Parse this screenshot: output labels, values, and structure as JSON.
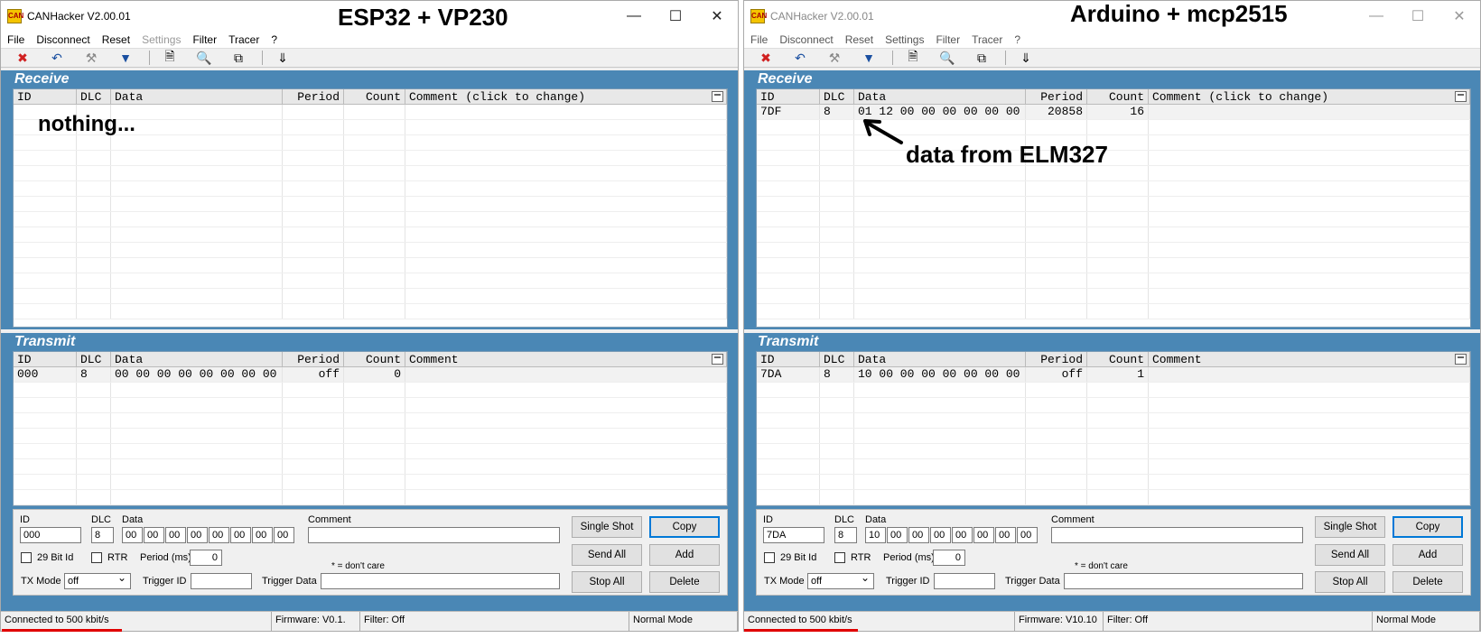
{
  "overlays": {
    "left_title": "ESP32 + VP230",
    "right_title": "Arduino + mcp2515",
    "left_note": "nothing...",
    "right_note": "data from ELM327",
    "right_arrow_icon": "arrow-up-left-icon"
  },
  "colors": {
    "panel": "#4a87b5",
    "accent": "#0078d7",
    "status_underline": "#e00000"
  },
  "left": {
    "title": "CANHacker V2.00.01",
    "menu": [
      "File",
      "Disconnect",
      "Reset",
      "Settings",
      "Filter",
      "Tracer",
      "?"
    ],
    "receive": {
      "heading": "Receive",
      "columns": [
        "ID",
        "DLC",
        "Data",
        "Period",
        "Count",
        "Comment (click to change)"
      ],
      "rows": []
    },
    "transmit": {
      "heading": "Transmit",
      "columns": [
        "ID",
        "DLC",
        "Data",
        "Period",
        "Count",
        "Comment"
      ],
      "rows": [
        {
          "id": "000",
          "dlc": "8",
          "data": "00 00 00 00 00 00 00 00",
          "period": "off",
          "count": "0",
          "comment": ""
        }
      ]
    },
    "editor": {
      "id_label": "ID",
      "id_value": "000",
      "dlc_label": "DLC",
      "dlc_value": "8",
      "data_label": "Data",
      "data_bytes": [
        "00",
        "00",
        "00",
        "00",
        "00",
        "00",
        "00",
        "00"
      ],
      "comment_label": "Comment",
      "comment_value": "",
      "bit29_label": "29 Bit Id",
      "rtr_label": "RTR",
      "period_label": "Period (ms)",
      "period_value": "0",
      "dont_care": "* = don't care",
      "txmode_label": "TX Mode",
      "txmode_value": "off",
      "trigger_id_label": "Trigger ID",
      "trigger_data_label": "Trigger Data",
      "buttons": {
        "single_shot": "Single Shot",
        "copy": "Copy",
        "send_all": "Send All",
        "add": "Add",
        "stop_all": "Stop All",
        "delete": "Delete"
      }
    },
    "status": {
      "connection": "Connected to 500 kbit/s",
      "firmware": "Firmware: V0.1.",
      "filter": "Filter: Off",
      "mode": "Normal Mode"
    }
  },
  "right": {
    "title": "CANHacker V2.00.01",
    "menu": [
      "File",
      "Disconnect",
      "Reset",
      "Settings",
      "Filter",
      "Tracer",
      "?"
    ],
    "receive": {
      "heading": "Receive",
      "columns": [
        "ID",
        "DLC",
        "Data",
        "Period",
        "Count",
        "Comment (click to change)"
      ],
      "rows": [
        {
          "id": "7DF",
          "dlc": "8",
          "data": "01 12 00 00 00 00 00 00",
          "period": "20858",
          "count": "16",
          "comment": ""
        }
      ]
    },
    "transmit": {
      "heading": "Transmit",
      "columns": [
        "ID",
        "DLC",
        "Data",
        "Period",
        "Count",
        "Comment"
      ],
      "rows": [
        {
          "id": "7DA",
          "dlc": "8",
          "data": "10 00 00 00 00 00 00 00",
          "period": "off",
          "count": "1",
          "comment": ""
        }
      ]
    },
    "editor": {
      "id_label": "ID",
      "id_value": "7DA",
      "dlc_label": "DLC",
      "dlc_value": "8",
      "data_label": "Data",
      "data_bytes": [
        "10",
        "00",
        "00",
        "00",
        "00",
        "00",
        "00",
        "00"
      ],
      "comment_label": "Comment",
      "comment_value": "",
      "bit29_label": "29 Bit Id",
      "rtr_label": "RTR",
      "period_label": "Period (ms)",
      "period_value": "0",
      "dont_care": "* = don't care",
      "txmode_label": "TX Mode",
      "txmode_value": "off",
      "trigger_id_label": "Trigger ID",
      "trigger_data_label": "Trigger Data",
      "buttons": {
        "single_shot": "Single Shot",
        "copy": "Copy",
        "send_all": "Send All",
        "add": "Add",
        "stop_all": "Stop All",
        "delete": "Delete"
      }
    },
    "status": {
      "connection": "Connected to 500 kbit/s",
      "firmware": "Firmware: V10.10",
      "filter": "Filter: Off",
      "mode": "Normal Mode"
    }
  }
}
